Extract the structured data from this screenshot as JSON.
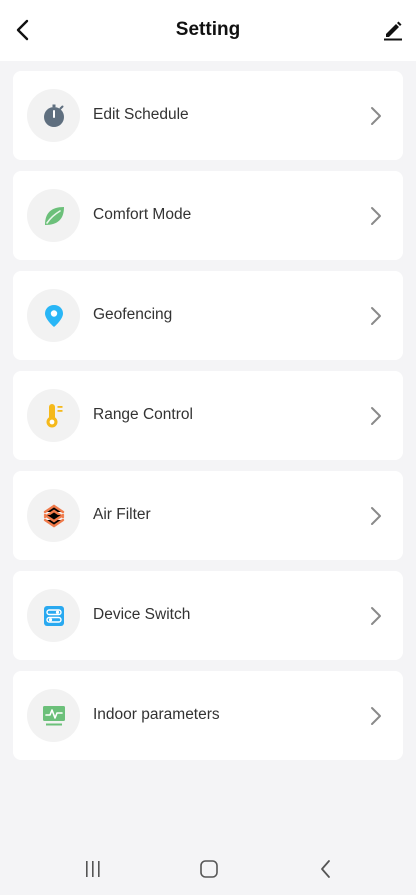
{
  "header": {
    "title": "Setting",
    "back_icon": "chevron-left-icon",
    "edit_icon": "pencil-icon"
  },
  "items": [
    {
      "label": "Edit Schedule",
      "icon": "timer-icon",
      "icon_color": "#5f6f7f"
    },
    {
      "label": "Comfort Mode",
      "icon": "leaf-icon",
      "icon_color": "#6cc07a"
    },
    {
      "label": "Geofencing",
      "icon": "location-pin-icon",
      "icon_color": "#29b6f6"
    },
    {
      "label": "Range Control",
      "icon": "thermometer-icon",
      "icon_color": "#f5b91b"
    },
    {
      "label": "Air Filter",
      "icon": "filter-grid-icon",
      "icon_color": "#f07a4a"
    },
    {
      "label": "Device Switch",
      "icon": "toggle-switch-icon",
      "icon_color": "#29a9f0"
    },
    {
      "label": "Indoor parameters",
      "icon": "monitor-chart-icon",
      "icon_color": "#6cc07a"
    }
  ],
  "navbar": {
    "recent_icon": "recent-apps-icon",
    "home_icon": "home-icon",
    "back_icon": "back-icon"
  }
}
